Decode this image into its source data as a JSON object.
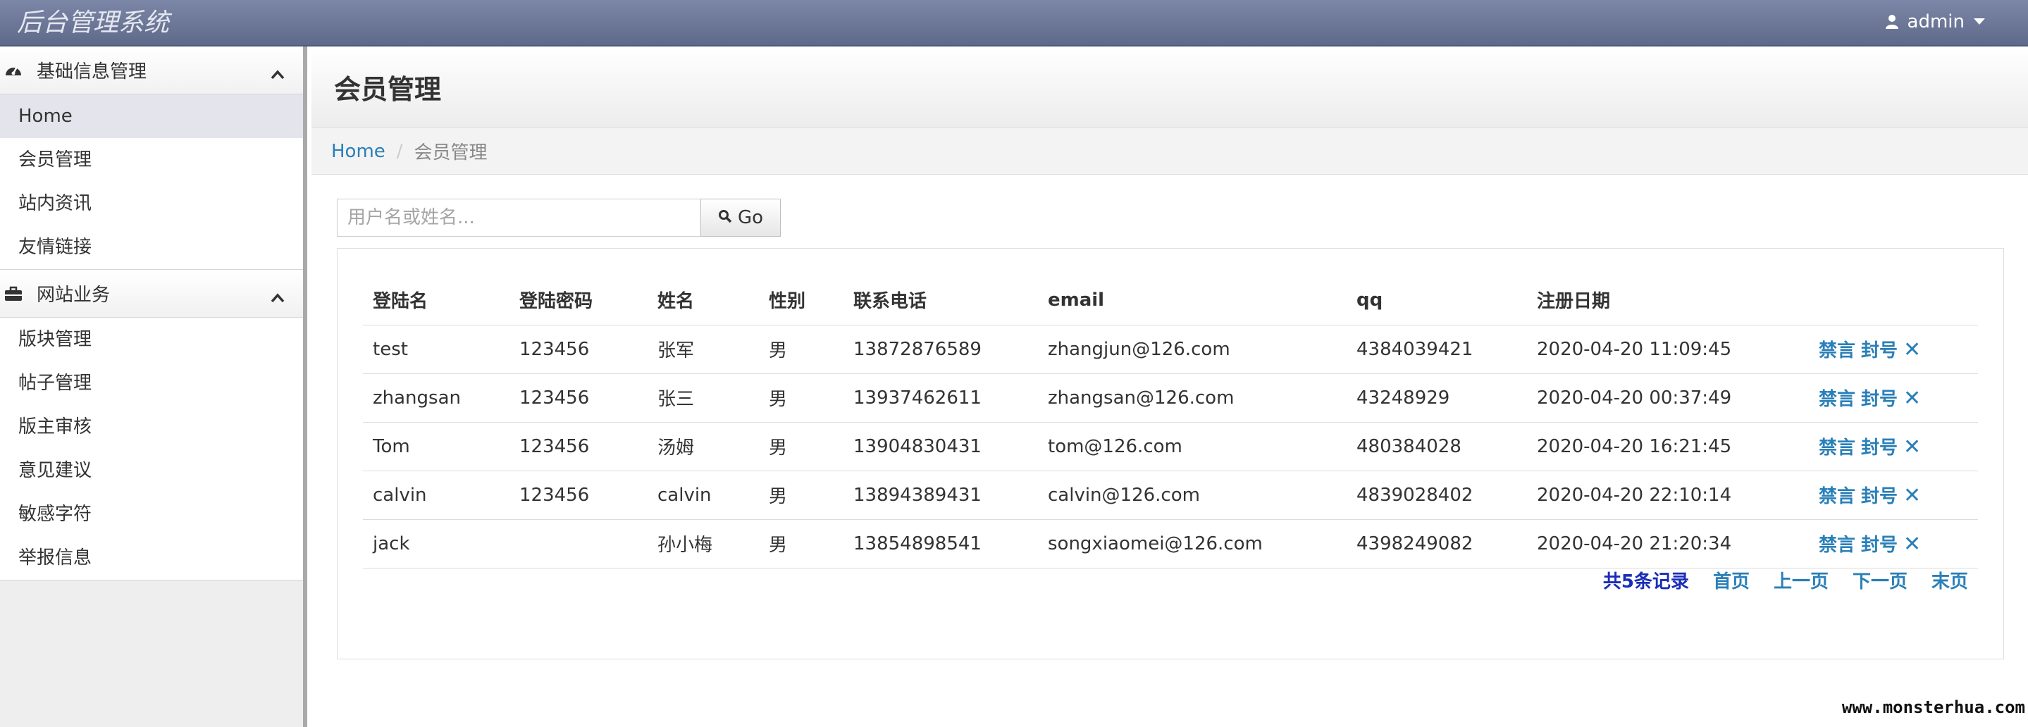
{
  "app": {
    "title": "后台管理系统",
    "user": "admin"
  },
  "sidebar": {
    "sections": [
      {
        "title": "基础信息管理",
        "items": [
          "Home",
          "会员管理",
          "站内资讯",
          "友情链接"
        ]
      },
      {
        "title": "网站业务",
        "items": [
          "版块管理",
          "帖子管理",
          "版主审核",
          "意见建议",
          "敏感字符",
          "举报信息"
        ]
      }
    ]
  },
  "main": {
    "title": "会员管理",
    "breadcrumb": {
      "home": "Home",
      "current": "会员管理"
    },
    "search": {
      "placeholder": "用户名或姓名...",
      "button": "Go"
    },
    "table": {
      "headers": [
        "登陆名",
        "登陆密码",
        "姓名",
        "性别",
        "联系电话",
        "email",
        "qq",
        "注册日期",
        ""
      ],
      "rows": [
        {
          "login": "test",
          "password": "123456",
          "name": "张军",
          "gender": "男",
          "phone": "13872876589",
          "email": "zhangjun@126.com",
          "qq": "4384039421",
          "date": "2020-04-20 11:09:45"
        },
        {
          "login": "zhangsan",
          "password": "123456",
          "name": "张三",
          "gender": "男",
          "phone": "13937462611",
          "email": "zhangsan@126.com",
          "qq": "43248929",
          "date": "2020-04-20 00:37:49"
        },
        {
          "login": "Tom",
          "password": "123456",
          "name": "汤姆",
          "gender": "男",
          "phone": "13904830431",
          "email": "tom@126.com",
          "qq": "480384028",
          "date": "2020-04-20 16:21:45"
        },
        {
          "login": "calvin",
          "password": "123456",
          "name": "calvin",
          "gender": "男",
          "phone": "13894389431",
          "email": "calvin@126.com",
          "qq": "4839028402",
          "date": "2020-04-20 22:10:14"
        },
        {
          "login": "jack",
          "password": "",
          "name": "孙小梅",
          "gender": "男",
          "phone": "13854898541",
          "email": "songxiaomei@126.com",
          "qq": "4398249082",
          "date": "2020-04-20 21:20:34"
        }
      ],
      "actions": {
        "mute": "禁言",
        "ban": "封号",
        "delete": "✕"
      }
    },
    "pager": {
      "total": "共5条记录",
      "first": "首页",
      "prev": "上一页",
      "next": "下一页",
      "last": "末页"
    }
  },
  "watermark": "www.monsterhua.com",
  "colors": {
    "topbar": "#6b7595",
    "link": "#2a7fb8",
    "total": "#1a2db8"
  }
}
